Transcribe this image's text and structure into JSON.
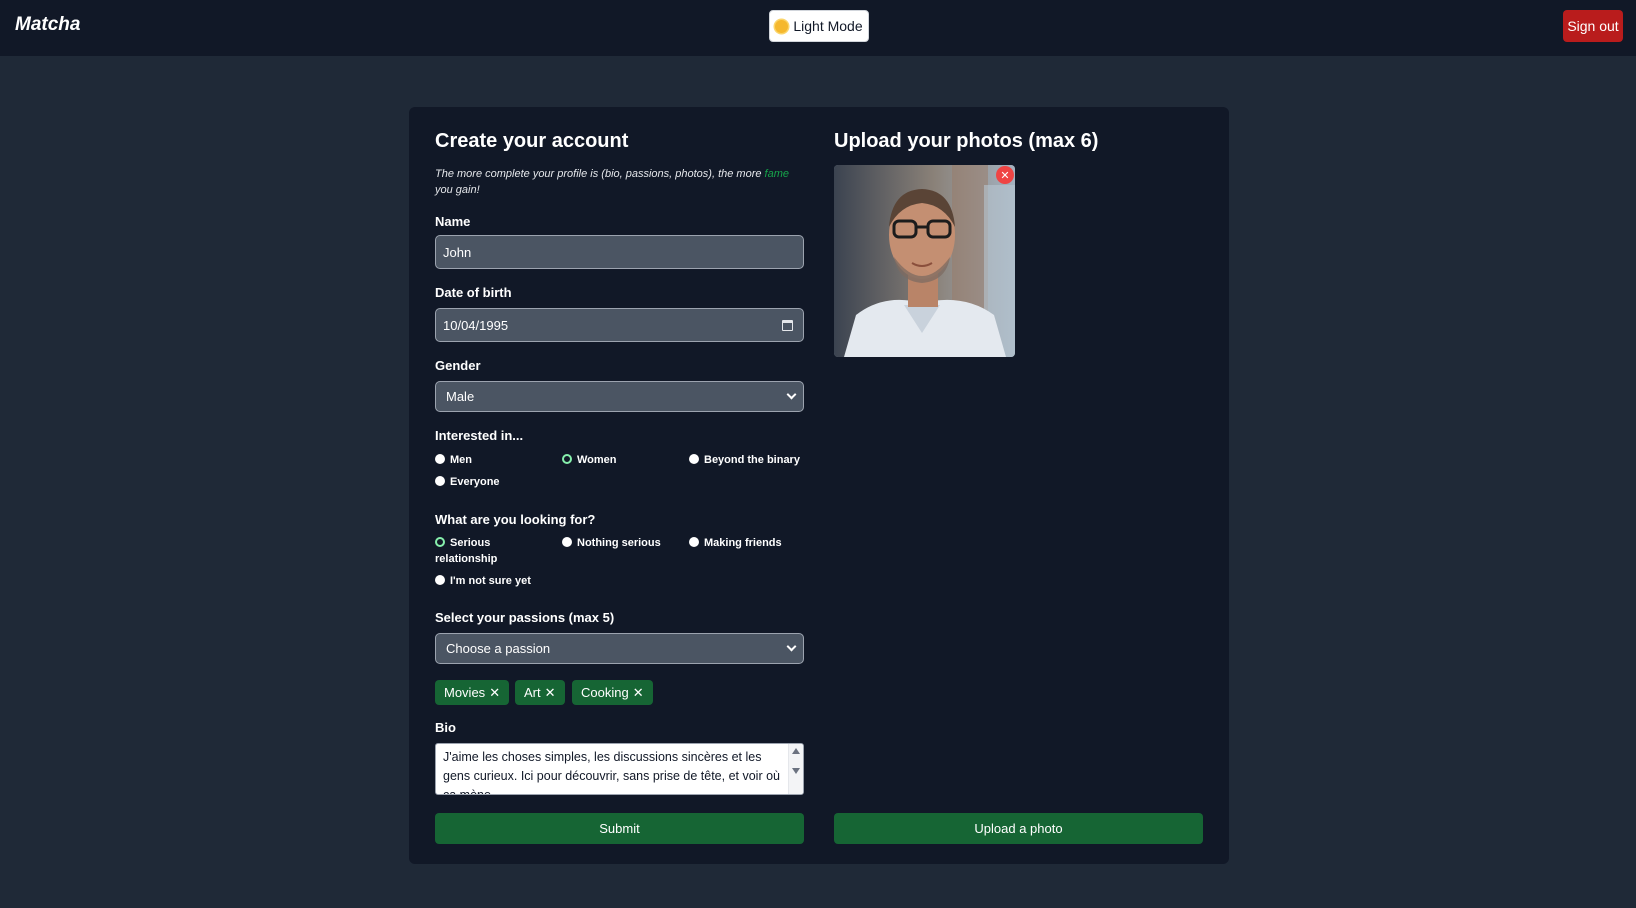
{
  "header": {
    "logo": "Matcha",
    "mode_button": "Light Mode",
    "sign_out": "Sign out"
  },
  "form": {
    "title": "Create your account",
    "hint_prefix": "The more complete your profile is (bio, passions, photos), the more",
    "hint_highlight": "fame",
    "hint_suffix": "you gain!",
    "name_label": "Name",
    "name_value": "John",
    "dob_label": "Date of birth",
    "dob_value": "10/04/1995",
    "gender_label": "Gender",
    "gender_value": "Male",
    "interested_label": "Interested in...",
    "interested_options": [
      "Men",
      "Women",
      "Beyond the binary",
      "Everyone"
    ],
    "interested_selected": "Women",
    "looking_label": "What are you looking for?",
    "looking_options": [
      "Serious relationship",
      "Nothing serious",
      "Making friends",
      "I'm not sure yet"
    ],
    "looking_selected": "Serious relationship",
    "passions_label": "Select your passions (max 5)",
    "passions_placeholder": "Choose a passion",
    "passions": [
      "Movies",
      "Art",
      "Cooking"
    ],
    "bio_label": "Bio",
    "bio_value": "J'aime les choses simples, les discussions sincères et les gens curieux. Ici pour découvrir, sans prise de tête, et voir où ça mène.",
    "submit": "Submit"
  },
  "photos": {
    "title": "Upload your photos (max 6)",
    "upload": "Upload a photo",
    "delete_glyph": "✕"
  },
  "colors": {
    "accent_green": "#166534",
    "danger_red": "#b91c1c",
    "card_bg": "#111827",
    "page_bg": "#1f2937"
  }
}
